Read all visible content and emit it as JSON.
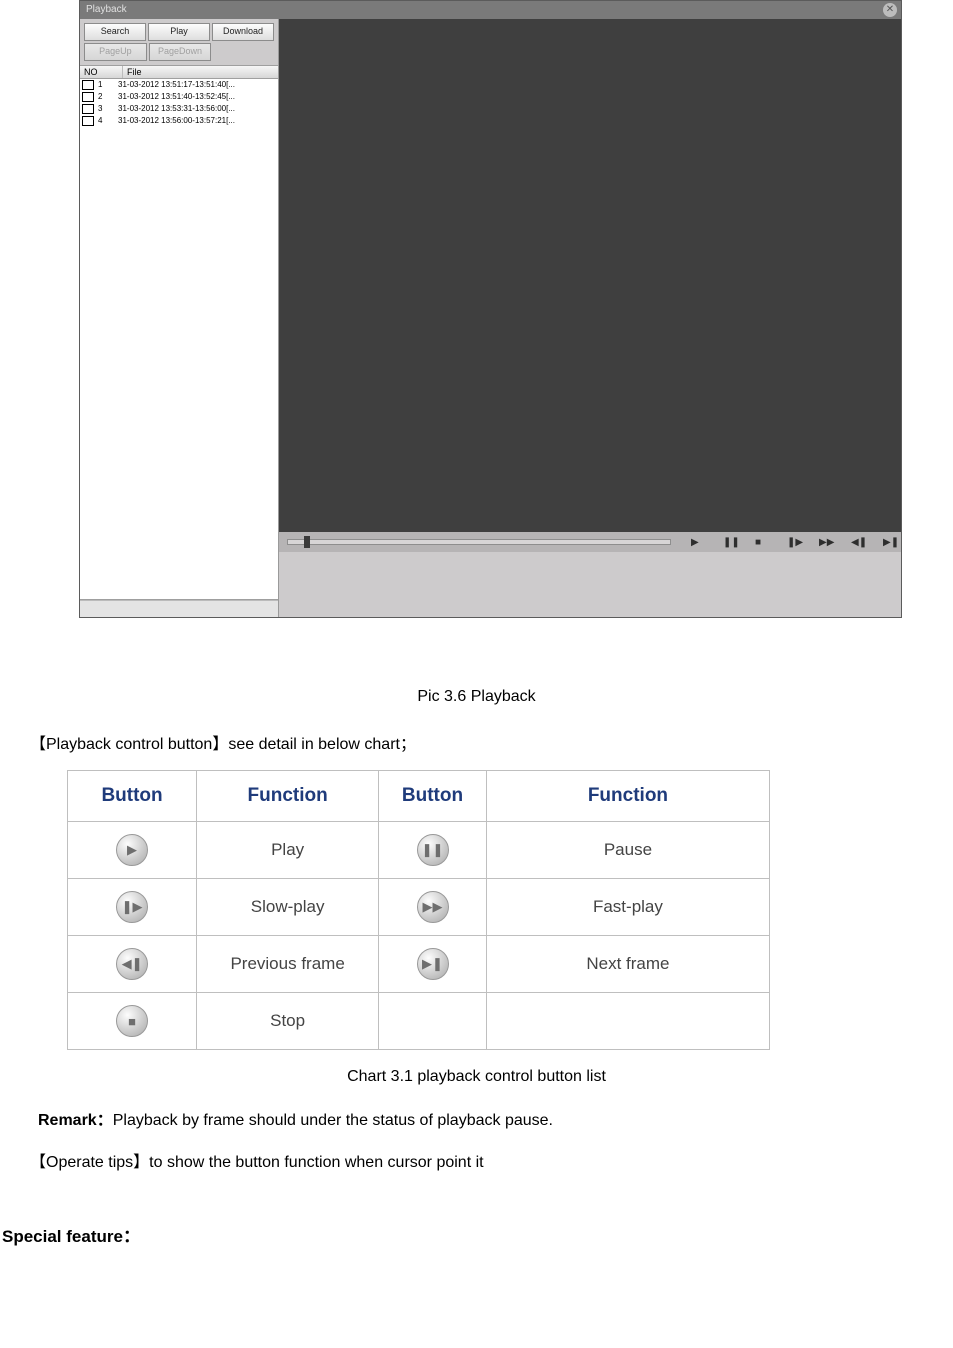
{
  "playback_window": {
    "title": "Playback",
    "buttons_row1": {
      "search": "Search",
      "play": "Play",
      "download": "Download"
    },
    "buttons_row2": {
      "pageup": "PageUp",
      "pagedown": "PageDown"
    },
    "list_header": {
      "no": "NO",
      "file": "File"
    },
    "rows": [
      {
        "no": "1",
        "file": "31-03-2012 13:51:17-13:51:40[..."
      },
      {
        "no": "2",
        "file": "31-03-2012 13:51:40-13:52:45[..."
      },
      {
        "no": "3",
        "file": "31-03-2012 13:53:31-13:56:00[..."
      },
      {
        "no": "4",
        "file": "31-03-2012 13:56:00-13:57:21[..."
      }
    ],
    "toolbar_icons": {
      "play": "▶",
      "pause": "❚❚",
      "stop": "■",
      "slow": "❚▶",
      "fast": "▶▶",
      "prev": "◀❚",
      "next": "▶❚"
    }
  },
  "doc": {
    "caption_screenshot": "Pic 3.6 Playback",
    "section_label": "【Playback control button】see detail in below chart；",
    "caption_table": "Chart 3.1 playback control button list",
    "remark_label": "Remark：",
    "remark_text": "Playback by frame should under the status of playback pause.",
    "operate_tips": "【Operate tips】to show the button function when cursor point it",
    "special_feature": "Special feature："
  },
  "table": {
    "headers": {
      "button": "Button",
      "function": "Function"
    },
    "rows": [
      {
        "icon1": "▶",
        "func1": "Play",
        "icon2": "❚❚",
        "func2": "Pause"
      },
      {
        "icon1": "❚▶",
        "func1": "Slow-play",
        "icon2": "▶▶",
        "func2": "Fast-play"
      },
      {
        "icon1": "◀❚",
        "func1": "Previous frame",
        "icon2": "▶❚",
        "func2": "Next frame"
      },
      {
        "icon1": "■",
        "func1": "Stop",
        "icon2": "",
        "func2": ""
      }
    ]
  }
}
